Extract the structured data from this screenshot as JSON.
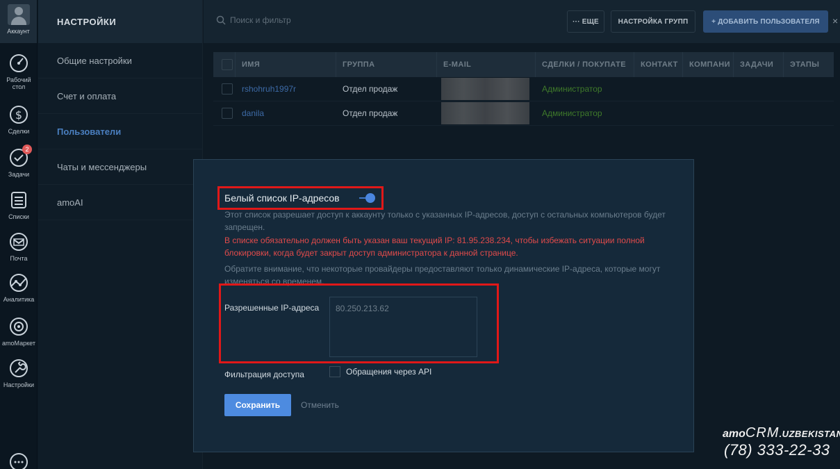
{
  "rail": {
    "account_label": "Аккаунт",
    "items": [
      {
        "label": "Рабочий стол",
        "icon": "speedometer-icon"
      },
      {
        "label": "Сделки",
        "icon": "dollar-icon"
      },
      {
        "label": "Задачи",
        "icon": "check-circle-icon",
        "badge": "2"
      },
      {
        "label": "Списки",
        "icon": "list-icon"
      },
      {
        "label": "Почта",
        "icon": "mail-icon"
      },
      {
        "label": "Аналитика",
        "icon": "analytics-icon"
      },
      {
        "label": "amoМаркет",
        "icon": "market-icon"
      },
      {
        "label": "Настройки",
        "icon": "wrench-icon"
      }
    ]
  },
  "settings": {
    "title": "НАСТРОЙКИ",
    "items": [
      {
        "label": "Общие настройки"
      },
      {
        "label": "Счет и оплата"
      },
      {
        "label": "Пользователи",
        "active": true
      },
      {
        "label": "Чаты и мессенджеры"
      },
      {
        "label": "amoAI"
      }
    ]
  },
  "topbar": {
    "search_placeholder": "Поиск и фильтр",
    "more_label": "··· ЕЩЕ",
    "groups_label": "НАСТРОЙКА ГРУПП",
    "add_user_label": "+ ДОБАВИТЬ ПОЛЬЗОВАТЕЛЯ",
    "close_label": "×"
  },
  "table": {
    "columns": [
      "ИМЯ",
      "ГРУППА",
      "E-MAIL",
      "СДЕЛКИ / ПОКУПАТЕ",
      "КОНТАКТ",
      "КОМПАНИ",
      "ЗАДАЧИ",
      "ЭТАПЫ"
    ],
    "rows": [
      {
        "name": "rshohruh1997r",
        "group": "Отдел продаж",
        "role": "Администратор"
      },
      {
        "name": "danila",
        "group": "Отдел продаж",
        "role": "Администратор"
      }
    ]
  },
  "modal": {
    "title": "Белый список IP-адресов",
    "toggle_on": true,
    "description": "Этот список разрешает доступ к аккаунту только с указанных IP-адресов, доступ с остальных компьютеров будет запрещен.",
    "warning": "В списке обязательно должен быть указан ваш текущий IP: 81.95.238.234, чтобы избежать ситуации полной блокировки, когда будет закрыт доступ администратора к данной странице.",
    "note": "Обратите внимание, что некоторые провайдеры предоставляют только динамические IP-адреса, которые могут изменяться со временем.",
    "ip_label": "Разрешенные IP-адреса",
    "ip_value": "80.250.213.62",
    "filter_label": "Фильтрация доступа",
    "api_checkbox_label": "Обращения через API",
    "api_checked": false,
    "save_label": "Сохранить",
    "cancel_label": "Отменить"
  },
  "watermark": {
    "brand_amo": "amo",
    "brand_crm": "CRM",
    "brand_uz": ".UZBEKISTAN",
    "phone": "(78) 333-22-33"
  },
  "colors": {
    "accent": "#4d8be0",
    "warning": "#e24b4b",
    "highlight": "#e01818",
    "role_green": "#3f7a2a"
  }
}
